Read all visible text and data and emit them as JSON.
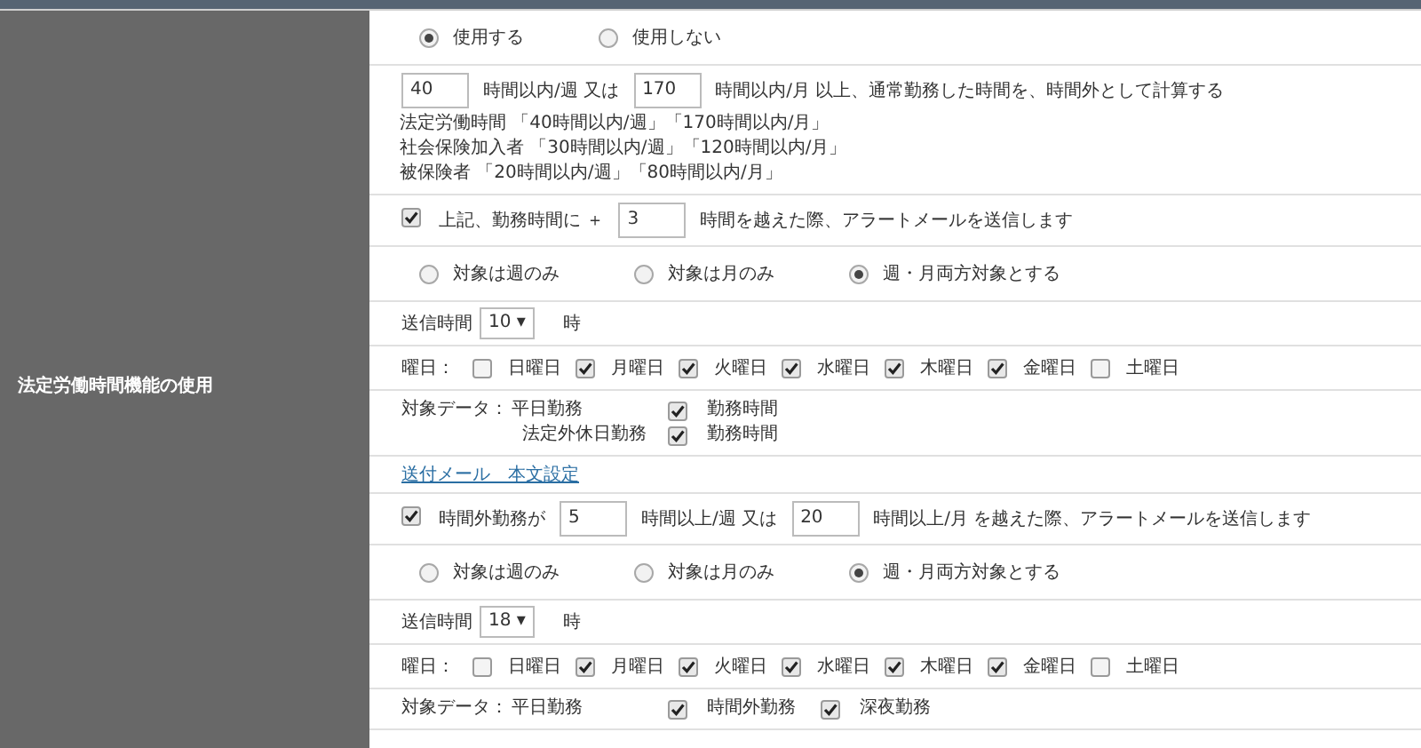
{
  "setting": {
    "label": "法定労働時間機能の使用",
    "rows": [
      {
        "kind": "radios",
        "options": [
          {
            "label": "使用する",
            "selected": true
          },
          {
            "label": "使用しない",
            "selected": false
          }
        ]
      },
      {
        "kind": "inputs",
        "parts": [
          {
            "kind": "input",
            "value": "40"
          },
          {
            "kind": "text",
            "text": "時間以内/週 又は"
          },
          {
            "kind": "input",
            "value": "170"
          },
          {
            "kind": "text",
            "text": "時間以内/月 以上、通常勤務した時間を、時間外として計算する"
          }
        ],
        "notes": [
          "法定労働時間 「40時間以内/週」「170時間以内/月」",
          "社会保険加入者 「30時間以内/週」「120時間以内/月」",
          "被保険者 「20時間以内/週」「80時間以内/月」"
        ]
      },
      {
        "kind": "inputs",
        "checked": true,
        "parts": [
          {
            "kind": "text",
            "text": "上記、勤務時間に ＋"
          },
          {
            "kind": "input",
            "value": "3"
          },
          {
            "kind": "text",
            "text": "時間を越えた際、アラートメールを送信します"
          }
        ]
      },
      {
        "kind": "radios",
        "options": [
          {
            "label": "対象は週のみ",
            "selected": false
          },
          {
            "label": "対象は月のみ",
            "selected": false
          },
          {
            "label": "週・月両方対象とする",
            "selected": true
          }
        ]
      },
      {
        "kind": "select",
        "label": "送信時間",
        "value": "10 ▾",
        "suffix": "時"
      },
      {
        "kind": "weekdays",
        "label": "曜日：",
        "days": [
          {
            "label": "日曜日",
            "checked": false
          },
          {
            "label": "月曜日",
            "checked": true
          },
          {
            "label": "火曜日",
            "checked": true
          },
          {
            "label": "水曜日",
            "checked": true
          },
          {
            "label": "木曜日",
            "checked": true
          },
          {
            "label": "金曜日",
            "checked": true
          },
          {
            "label": "土曜日",
            "checked": false
          }
        ]
      },
      {
        "kind": "targets",
        "label": "対象データ：",
        "groups": [
          {
            "label": "平日勤務",
            "items": [
              {
                "label": "勤務時間",
                "checked": true
              }
            ]
          },
          {
            "label": "法定外休日勤務",
            "items": [
              {
                "label": "勤務時間",
                "checked": true
              }
            ]
          }
        ]
      },
      {
        "kind": "link",
        "text": "送付メール　本文設定"
      },
      {
        "kind": "inputs",
        "checked": true,
        "parts": [
          {
            "kind": "text",
            "text": "時間外勤務が"
          },
          {
            "kind": "input",
            "value": "5"
          },
          {
            "kind": "text",
            "text": "時間以上/週 又は"
          },
          {
            "kind": "input",
            "value": "20"
          },
          {
            "kind": "text",
            "text": "時間以上/月 を越えた際、アラートメールを送信します"
          }
        ]
      },
      {
        "kind": "radios",
        "options": [
          {
            "label": "対象は週のみ",
            "selected": false
          },
          {
            "label": "対象は月のみ",
            "selected": false
          },
          {
            "label": "週・月両方対象とする",
            "selected": true
          }
        ]
      },
      {
        "kind": "select",
        "label": "送信時間",
        "value": "18 ▾",
        "suffix": "時"
      },
      {
        "kind": "weekdays",
        "label": "曜日：",
        "days": [
          {
            "label": "日曜日",
            "checked": false
          },
          {
            "label": "月曜日",
            "checked": true
          },
          {
            "label": "火曜日",
            "checked": true
          },
          {
            "label": "水曜日",
            "checked": true
          },
          {
            "label": "木曜日",
            "checked": true
          },
          {
            "label": "金曜日",
            "checked": true
          },
          {
            "label": "土曜日",
            "checked": false
          }
        ]
      },
      {
        "kind": "targets",
        "label": "対象データ：",
        "groups": [
          {
            "label": "平日勤務",
            "items": [
              {
                "label": "時間外勤務",
                "checked": true
              },
              {
                "label": "深夜勤務",
                "checked": true
              }
            ]
          }
        ]
      }
    ]
  }
}
